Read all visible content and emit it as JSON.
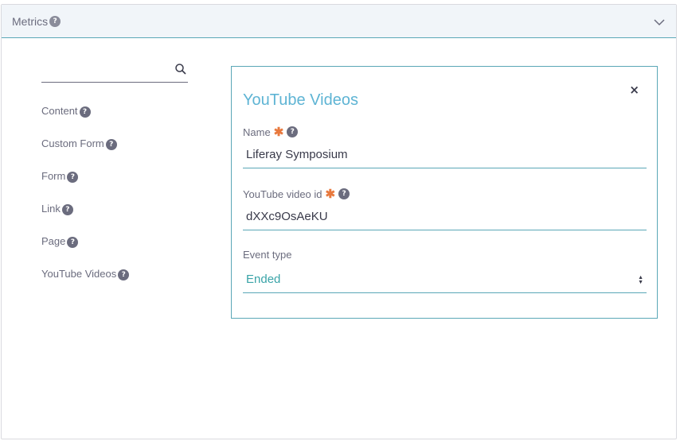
{
  "panel": {
    "title": "Metrics",
    "help": "?"
  },
  "search": {
    "value": "",
    "placeholder": ""
  },
  "types": [
    {
      "label": "Content",
      "help": "?"
    },
    {
      "label": "Custom Form",
      "help": "?"
    },
    {
      "label": "Form",
      "help": "?"
    },
    {
      "label": "Link",
      "help": "?"
    },
    {
      "label": "Page",
      "help": "?"
    },
    {
      "label": "YouTube Videos",
      "help": "?"
    }
  ],
  "card": {
    "title": "YouTube Videos",
    "close": "×",
    "fields": {
      "name": {
        "label": "Name",
        "required": "✱",
        "help": "?",
        "value": "Liferay Symposium"
      },
      "video_id": {
        "label": "YouTube video id",
        "required": "✱",
        "help": "?",
        "value": "dXXc9OsAeKU"
      },
      "event_type": {
        "label": "Event type",
        "value": "Ended"
      }
    }
  },
  "colors": {
    "accent": "#5aa7b7",
    "title": "#5eb4d4",
    "required": "#e8793e",
    "header_bg": "#f1f5f9"
  }
}
